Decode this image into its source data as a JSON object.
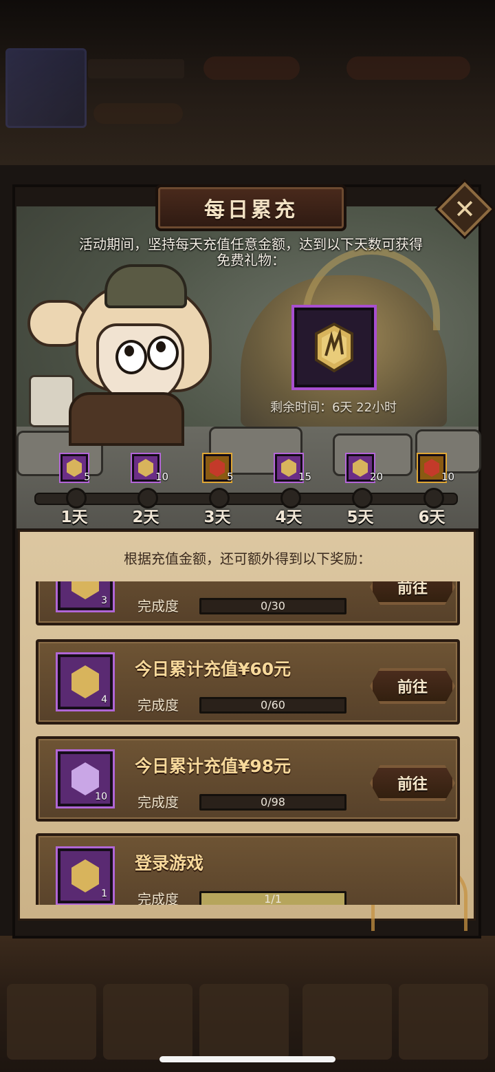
{
  "dialog": {
    "title": "每日累充",
    "close_icon": "close-x-icon",
    "description": "活动期间，坚持每天充值任意金额，达到以下天数可获得免费礼物：",
    "remaining_time": "剩余时间：6天 22小时",
    "featured_reward_icon": "crystal-shard-icon"
  },
  "days": [
    {
      "label": "1天",
      "count": "5",
      "icon": "crystal-shard-icon",
      "rarity": "purple"
    },
    {
      "label": "2天",
      "count": "10",
      "icon": "crystal-shard-icon",
      "rarity": "purple"
    },
    {
      "label": "3天",
      "count": "5",
      "icon": "hero-card-icon",
      "rarity": "gold"
    },
    {
      "label": "4天",
      "count": "15",
      "icon": "crystal-shard-icon",
      "rarity": "purple"
    },
    {
      "label": "5天",
      "count": "20",
      "icon": "crystal-shard-icon",
      "rarity": "purple"
    },
    {
      "label": "6天",
      "count": "10",
      "icon": "hero-card-icon",
      "rarity": "gold"
    }
  ],
  "bonus_heading": "根据充值金额，还可额外得到以下奖励：",
  "tasks": [
    {
      "title": "",
      "reward_count": "3",
      "progress_label": "完成度",
      "progress_text": "0/30",
      "progress": 0,
      "button_label": "前往"
    },
    {
      "title": "今日累计充值¥60元",
      "reward_count": "4",
      "progress_label": "完成度",
      "progress_text": "0/60",
      "progress": 0,
      "button_label": "前往"
    },
    {
      "title": "今日累计充值¥98元",
      "reward_count": "10",
      "progress_label": "完成度",
      "progress_text": "0/98",
      "progress": 0,
      "button_label": "前往"
    },
    {
      "title": "登录游戏",
      "reward_count": "1",
      "progress_label": "完成度",
      "progress_text": "1/1",
      "progress": 1,
      "button_label": ""
    }
  ],
  "colors": {
    "purple_rarity": "#a84fd0",
    "gold_rarity": "#e0a734",
    "title_gold": "#f6d89a"
  }
}
